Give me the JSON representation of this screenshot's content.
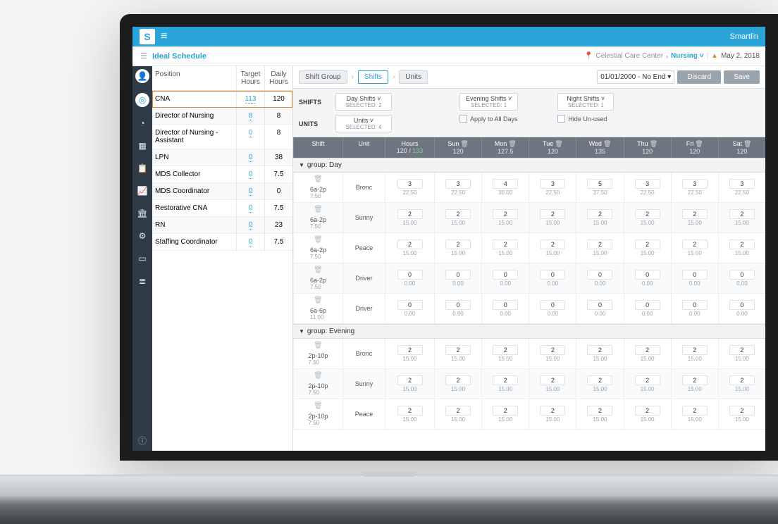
{
  "topbar": {
    "brand": "Smartlin"
  },
  "subheader": {
    "icon": "calendar",
    "title": "Ideal Schedule",
    "location": "Celestial Care Center",
    "department": "Nursing",
    "date": "May 2, 2018"
  },
  "positions": {
    "headers": {
      "position": "Position",
      "target": "Target Hours",
      "daily": "Daily Hours"
    },
    "rows": [
      {
        "name": "CNA",
        "target": "113",
        "daily": "120",
        "selected": true
      },
      {
        "name": "Director of Nursing",
        "target": "8",
        "daily": "8"
      },
      {
        "name": "Director of Nursing - Assistant",
        "target": "0",
        "daily": "8"
      },
      {
        "name": "LPN",
        "target": "0",
        "daily": "38"
      },
      {
        "name": "MDS Collector",
        "target": "0",
        "daily": "7.5"
      },
      {
        "name": "MDS Coordinator",
        "target": "0",
        "daily": "0"
      },
      {
        "name": "Restorative CNA",
        "target": "0",
        "daily": "7.5"
      },
      {
        "name": "RN",
        "target": "0",
        "daily": "23"
      },
      {
        "name": "Staffing Coordinator",
        "target": "0",
        "daily": "7.5"
      }
    ]
  },
  "toolbar": {
    "crumbs": [
      "Shift Group",
      "Shifts",
      "Units"
    ],
    "range": "01/01/2000 - No End",
    "discard": "Discard",
    "save": "Save"
  },
  "filters": {
    "shifts_label": "SHIFTS",
    "units_label": "UNITS",
    "day": {
      "label": "Day Shifts",
      "sub": "SELECTED: 2"
    },
    "evening": {
      "label": "Evening Shifts",
      "sub": "SELECTED: 1"
    },
    "night": {
      "label": "Night Shifts",
      "sub": "SELECTED: 1"
    },
    "units": {
      "label": "Units",
      "sub": "SELECTED: 4"
    },
    "apply": "Apply to All Days",
    "hide": "Hide Un-used"
  },
  "gridhead": {
    "shift": "Shift",
    "unit": "Unit",
    "hours": "Hours",
    "hours_sub_a": "120",
    "hours_sub_b": "133",
    "days": [
      {
        "name": "Sun",
        "val": "120"
      },
      {
        "name": "Mon",
        "val": "127.5"
      },
      {
        "name": "Tue",
        "val": "120"
      },
      {
        "name": "Wed",
        "val": "135"
      },
      {
        "name": "Thu",
        "val": "120"
      },
      {
        "name": "Fri",
        "val": "120"
      },
      {
        "name": "Sat",
        "val": "120"
      }
    ]
  },
  "groups": [
    {
      "title": "group: Day",
      "rows": [
        {
          "shift": "6a-2p",
          "shsub": "7.50",
          "unit": "Bronc",
          "days": [
            {
              "c": "3",
              "h": "22.50"
            },
            {
              "c": "3",
              "h": "22.50"
            },
            {
              "c": "4",
              "h": "30.00"
            },
            {
              "c": "3",
              "h": "22.50"
            },
            {
              "c": "5",
              "h": "37.50"
            },
            {
              "c": "3",
              "h": "22.50"
            },
            {
              "c": "3",
              "h": "22.50"
            },
            {
              "c": "3",
              "h": "22.50"
            }
          ]
        },
        {
          "shift": "6a-2p",
          "shsub": "7.50",
          "unit": "Sunny",
          "days": [
            {
              "c": "2",
              "h": "15.00"
            },
            {
              "c": "2",
              "h": "15.00"
            },
            {
              "c": "2",
              "h": "15.00"
            },
            {
              "c": "2",
              "h": "15.00"
            },
            {
              "c": "2",
              "h": "15.00"
            },
            {
              "c": "2",
              "h": "15.00"
            },
            {
              "c": "2",
              "h": "15.00"
            },
            {
              "c": "2",
              "h": "15.00"
            }
          ]
        },
        {
          "shift": "6a-2p",
          "shsub": "7.50",
          "unit": "Peace",
          "days": [
            {
              "c": "2",
              "h": "15.00"
            },
            {
              "c": "2",
              "h": "15.00"
            },
            {
              "c": "2",
              "h": "15.00"
            },
            {
              "c": "2",
              "h": "15.00"
            },
            {
              "c": "2",
              "h": "15.00"
            },
            {
              "c": "2",
              "h": "15.00"
            },
            {
              "c": "2",
              "h": "15.00"
            },
            {
              "c": "2",
              "h": "15.00"
            }
          ]
        },
        {
          "shift": "6a-2p",
          "shsub": "7.50",
          "unit": "Driver",
          "days": [
            {
              "c": "0",
              "h": "0.00"
            },
            {
              "c": "0",
              "h": "0.00"
            },
            {
              "c": "0",
              "h": "0.00"
            },
            {
              "c": "0",
              "h": "0.00"
            },
            {
              "c": "0",
              "h": "0.00"
            },
            {
              "c": "0",
              "h": "0.00"
            },
            {
              "c": "0",
              "h": "0.00"
            },
            {
              "c": "0",
              "h": "0.00"
            }
          ]
        },
        {
          "shift": "6a-6p",
          "shsub": "11.00",
          "unit": "Driver",
          "days": [
            {
              "c": "0",
              "h": "0.00"
            },
            {
              "c": "0",
              "h": "0.00"
            },
            {
              "c": "0",
              "h": "0.00"
            },
            {
              "c": "0",
              "h": "0.00"
            },
            {
              "c": "0",
              "h": "0.00"
            },
            {
              "c": "0",
              "h": "0.00"
            },
            {
              "c": "0",
              "h": "0.00"
            },
            {
              "c": "0",
              "h": "0.00"
            }
          ]
        }
      ]
    },
    {
      "title": "group: Evening",
      "rows": [
        {
          "shift": "2p-10p",
          "shsub": "7.50",
          "unit": "Bronc",
          "days": [
            {
              "c": "2",
              "h": "15.00"
            },
            {
              "c": "2",
              "h": "15.00"
            },
            {
              "c": "2",
              "h": "15.00"
            },
            {
              "c": "2",
              "h": "15.00"
            },
            {
              "c": "2",
              "h": "15.00"
            },
            {
              "c": "2",
              "h": "15.00"
            },
            {
              "c": "2",
              "h": "15.00"
            },
            {
              "c": "2",
              "h": "15.00"
            }
          ]
        },
        {
          "shift": "2p-10p",
          "shsub": "7.50",
          "unit": "Sunny",
          "days": [
            {
              "c": "2",
              "h": "15.00"
            },
            {
              "c": "2",
              "h": "15.00"
            },
            {
              "c": "2",
              "h": "15.00"
            },
            {
              "c": "2",
              "h": "15.00"
            },
            {
              "c": "2",
              "h": "15.00"
            },
            {
              "c": "2",
              "h": "15.00"
            },
            {
              "c": "2",
              "h": "15.00"
            },
            {
              "c": "2",
              "h": "15.00"
            }
          ]
        },
        {
          "shift": "2p-10p",
          "shsub": "7.50",
          "unit": "Peace",
          "days": [
            {
              "c": "2",
              "h": "15.00"
            },
            {
              "c": "2",
              "h": "15.00"
            },
            {
              "c": "2",
              "h": "15.00"
            },
            {
              "c": "2",
              "h": "15.00"
            },
            {
              "c": "2",
              "h": "15.00"
            },
            {
              "c": "2",
              "h": "15.00"
            },
            {
              "c": "2",
              "h": "15.00"
            },
            {
              "c": "2",
              "h": "15.00"
            }
          ]
        }
      ]
    }
  ]
}
